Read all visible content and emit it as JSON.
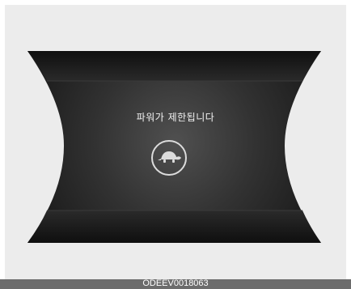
{
  "display": {
    "message": "파워가 제한됩니다",
    "indicator_icon": "turtle-icon"
  },
  "footer": {
    "figure_code": "ODEEV0018063"
  },
  "colors": {
    "background": "#ececec",
    "panel_dark": "#1b1b1b",
    "panel_center": "#4a4a4a",
    "text": "#f2f2f2",
    "footer_bar": "#6c6c6c"
  }
}
